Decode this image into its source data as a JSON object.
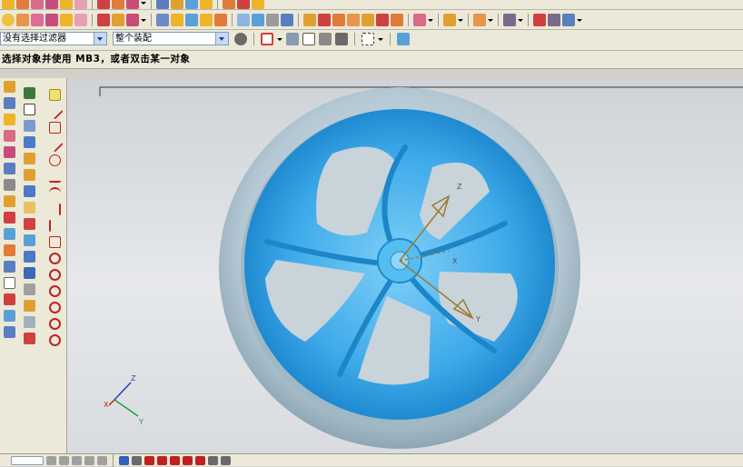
{
  "selection_bar": {
    "filter_value": "没有选择过滤器",
    "scope_value": "整个装配"
  },
  "cue_line": {
    "text": "选择对象并使用 MB3，或者双击某一对象"
  },
  "viewport": {
    "background_top": "#cfd3d7",
    "background_bottom": "#e6e8ea",
    "wheel_color": "#4ab3ec",
    "tire_color": "#b8cdd8",
    "part_csys": {
      "x_label": "X",
      "y_label": "Y",
      "z_label": "Z"
    },
    "view_triad": {
      "x_label": "X",
      "y_label": "Y",
      "z_label": "Z"
    }
  },
  "icons": {
    "toolbar_row1": [
      "sketch-icon",
      "extrude-icon",
      "revolve-icon",
      "hole-icon",
      "boss-icon",
      "pocket-icon",
      "pad-icon",
      "blend-icon",
      "chamfer-icon",
      "shell-icon",
      "mirror-icon",
      "pattern-icon",
      "trim-icon",
      "unite-icon",
      "subtract-icon",
      "intersect-icon"
    ],
    "toolbar_row2": [
      "view-fit-icon",
      "zoom-icon",
      "rotate-icon",
      "pan-icon",
      "render-shaded-icon",
      "render-wire-icon",
      "section-icon",
      "layer-icon",
      "display-icon",
      "color-icon",
      "material-icon",
      "analysis-icon"
    ],
    "selection_tools": [
      "snap-icon",
      "point-icon",
      "undo-icon",
      "cube-icon",
      "motion-icon",
      "select-box-icon",
      "shaded-cube-icon"
    ],
    "left_toolbar": [
      "assembly-icon",
      "part-icon",
      "component-icon",
      "constraint-icon",
      "point-icon",
      "line-icon",
      "arc-icon",
      "curve-icon",
      "spline-icon",
      "offset-icon",
      "datum-icon",
      "measure-icon"
    ]
  }
}
